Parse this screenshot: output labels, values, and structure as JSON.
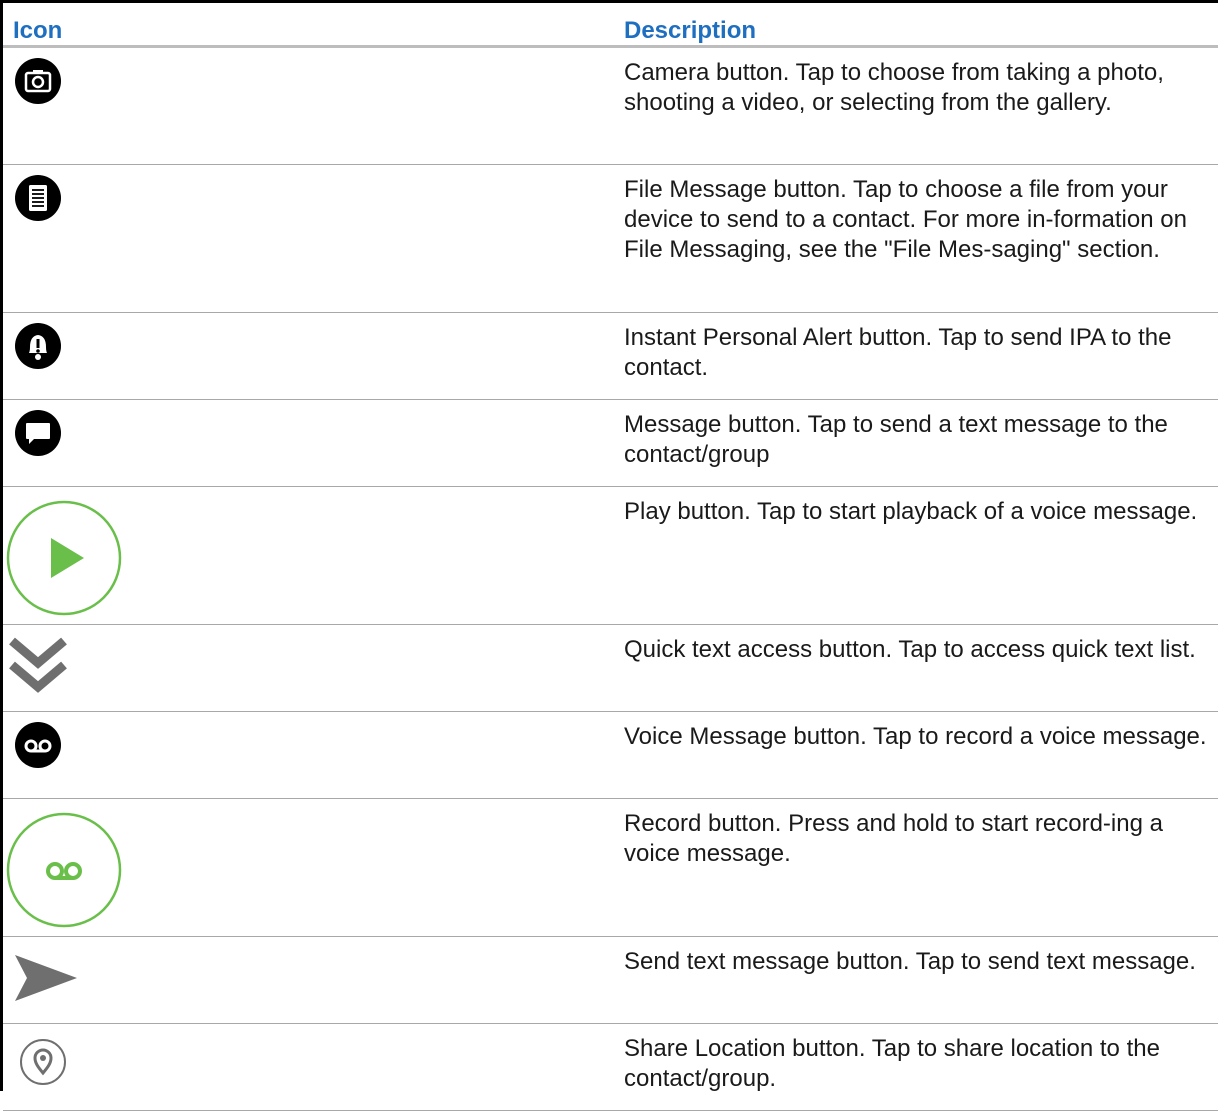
{
  "table": {
    "header_icon": "Icon",
    "header_description": "Description",
    "rows": [
      {
        "icon": "camera-icon",
        "description": "Camera button. Tap to choose from taking a photo, shooting a video, or selecting from the gallery."
      },
      {
        "icon": "file-message-icon",
        "description": "File Message button. Tap to choose a file from your device to send to a contact. For more in-formation on File Messaging, see the \"File Mes-saging\" section."
      },
      {
        "icon": "instant-personal-alert-icon",
        "description": "Instant Personal Alert button. Tap to send IPA to the contact."
      },
      {
        "icon": "message-icon",
        "description": "Message button. Tap to send a text message to the contact/group"
      },
      {
        "icon": "play-icon",
        "description": "Play button. Tap to start playback of a voice message."
      },
      {
        "icon": "quick-text-chevron-icon",
        "description": "Quick text access button. Tap to access quick text list."
      },
      {
        "icon": "voice-message-icon",
        "description": "Voice Message button. Tap to record a voice message."
      },
      {
        "icon": "record-icon",
        "description": "Record button. Press and hold to start record-ing a voice message."
      },
      {
        "icon": "send-icon",
        "description": "Send text message button. Tap to send text message."
      },
      {
        "icon": "share-location-icon",
        "description": "Share Location button. Tap to share location to the contact/group."
      }
    ]
  },
  "colors": {
    "header_text": "#1f6fc1",
    "icon_green": "#6abf4b",
    "icon_gray": "#6f6f6f"
  }
}
